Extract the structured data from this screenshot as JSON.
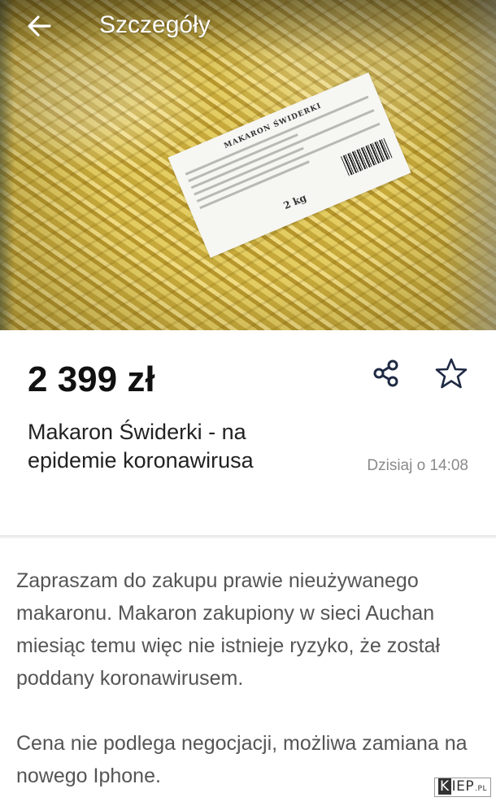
{
  "header": {
    "title": "Szczegóły",
    "back_icon": "arrow-left-icon"
  },
  "photo": {
    "description_icon": "product-photo",
    "label_text": "MAKARON ŚWIDERKI",
    "label_weight": "2 kg"
  },
  "listing": {
    "price": "2 399 zł",
    "title": "Makaron Świderki - na epidemie koronawirusa",
    "date": "Dzisiaj o 14:08",
    "share_icon": "share-icon",
    "favorite_icon": "star-outline-icon"
  },
  "description": {
    "paragraph_1": "Zapraszam do zakupu prawie nieużywanego makaronu. Makaron zakupiony w sieci Auchan miesiąc temu więc nie istnieje ryzyko, że został poddany koronawirusem.",
    "paragraph_2": "Cena nie podlega negocjacji, możliwa zamiana na nowego Iphone."
  },
  "watermark": {
    "k": "K",
    "rest": "IEP",
    "tld": ".PL"
  },
  "colors": {
    "price": "#111111",
    "text": "#555555",
    "muted": "#8a8a8a",
    "icon": "#1f2a44"
  }
}
